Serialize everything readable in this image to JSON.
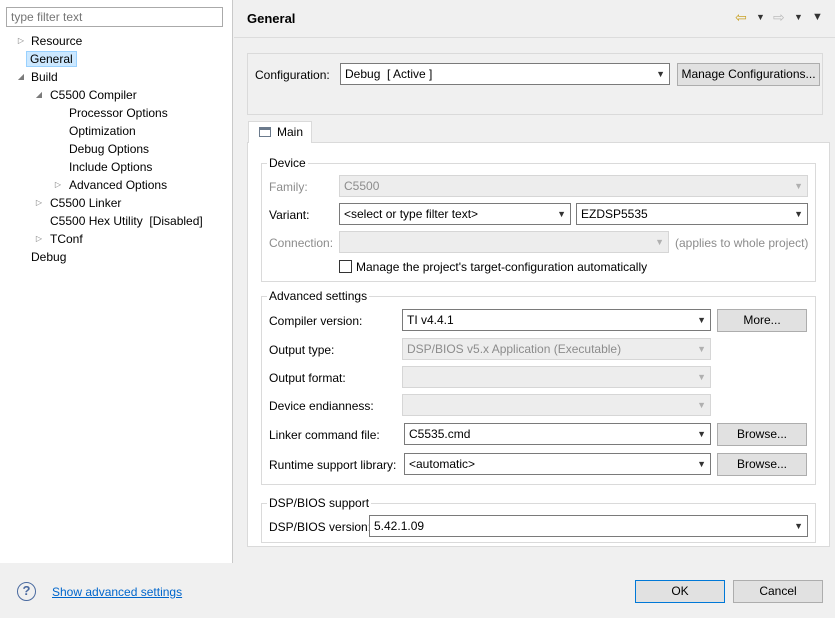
{
  "filter": {
    "placeholder": "type filter text"
  },
  "tree": [
    {
      "label": "Resource",
      "arrow": "▷"
    },
    {
      "label": "General",
      "arrow": ""
    },
    {
      "label": "Build",
      "arrow": "◢"
    },
    {
      "label": "C5500 Compiler",
      "arrow": "◢"
    },
    {
      "label": "Processor Options",
      "arrow": ""
    },
    {
      "label": "Optimization",
      "arrow": ""
    },
    {
      "label": "Debug Options",
      "arrow": ""
    },
    {
      "label": "Include Options",
      "arrow": ""
    },
    {
      "label": "Advanced Options",
      "arrow": "▷"
    },
    {
      "label": "C5500 Linker",
      "arrow": "▷"
    },
    {
      "label": "C5500 Hex Utility  [Disabled]",
      "arrow": ""
    },
    {
      "label": "TConf",
      "arrow": "▷"
    },
    {
      "label": "Debug",
      "arrow": ""
    }
  ],
  "header": {
    "title": "General",
    "icons": {
      "back": "back-arrow-icon",
      "forward": "forward-arrow-icon",
      "menu": "view-menu-icon"
    }
  },
  "configuration": {
    "label": "Configuration:",
    "value": "Debug  [ Active ]",
    "manage_button": "Manage Configurations..."
  },
  "tab": {
    "label": "Main",
    "icon": "main-tab-icon"
  },
  "device": {
    "title": "Device",
    "family_label": "Family:",
    "family_value": "C5500",
    "variant_label": "Variant:",
    "variant_filter": "<select or type filter text>",
    "variant_value": "EZDSP5535",
    "connection_label": "Connection:",
    "connection_value": "",
    "connection_note": "(applies to whole project)",
    "manage_checkbox_label": "Manage the project's target-configuration automatically"
  },
  "advanced": {
    "title": "Advanced settings",
    "compiler_label": "Compiler version:",
    "compiler_value": "TI v4.4.1",
    "more_button": "More...",
    "output_type_label": "Output type:",
    "output_type_value": "DSP/BIOS v5.x Application (Executable)",
    "output_format_label": "Output format:",
    "output_format_value": "",
    "endianness_label": "Device endianness:",
    "endianness_value": "",
    "linker_label": "Linker command file:",
    "linker_value": "C5535.cmd",
    "browse_button": "Browse...",
    "runtime_label": "Runtime support library:",
    "runtime_value": "<automatic>"
  },
  "dspbios": {
    "title": "DSP/BIOS support",
    "version_label": "DSP/BIOS version:",
    "version_value": "5.42.1.09"
  },
  "footer": {
    "show_advanced_link": "Show advanced settings",
    "ok_button": "OK",
    "cancel_button": "Cancel",
    "help_icon": "help-icon"
  },
  "colors": {
    "selection": "#cce8ff",
    "link": "#0066cc",
    "primary_border": "#0078d7"
  }
}
